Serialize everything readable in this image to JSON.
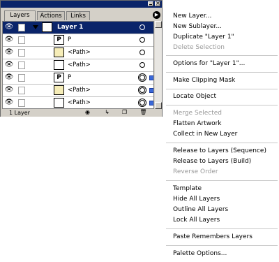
{
  "palette": {
    "tabs": [
      "Layers",
      "Actions",
      "Links"
    ],
    "layer_count": "1 Layer",
    "rows": [
      {
        "label": "Layer 1",
        "thumb": "",
        "kind": "layer"
      },
      {
        "label": "P",
        "thumb": "P",
        "kind": "text"
      },
      {
        "label": "<Path>",
        "thumb": "",
        "kind": "path"
      },
      {
        "label": "<Path>",
        "thumb": "",
        "kind": "path-white"
      },
      {
        "label": "P",
        "thumb": "P",
        "kind": "text-sel"
      },
      {
        "label": "<Path>",
        "thumb": "",
        "kind": "path-sel"
      },
      {
        "label": "<Path>",
        "thumb": "",
        "kind": "path-white-sel"
      }
    ],
    "icons": {
      "visibility": "eye-icon",
      "expand": "triangle-down-icon",
      "target": "target-circle-icon",
      "menu": "palette-menu-arrow-icon"
    }
  },
  "menu": {
    "groups": [
      [
        {
          "label": "New Layer...",
          "enabled": true
        },
        {
          "label": "New Sublayer...",
          "enabled": true
        },
        {
          "label": "Duplicate \"Layer 1\"",
          "enabled": true
        },
        {
          "label": "Delete Selection",
          "enabled": false
        }
      ],
      [
        {
          "label": "Options for \"Layer 1\"...",
          "enabled": true
        }
      ],
      [
        {
          "label": "Make Clipping Mask",
          "enabled": true
        }
      ],
      [
        {
          "label": "Locate Object",
          "enabled": true
        }
      ],
      [
        {
          "label": "Merge Selected",
          "enabled": false
        },
        {
          "label": "Flatten Artwork",
          "enabled": true
        },
        {
          "label": "Collect in New Layer",
          "enabled": true
        }
      ],
      [
        {
          "label": "Release to Layers (Sequence)",
          "enabled": true
        },
        {
          "label": "Release to Layers (Build)",
          "enabled": true
        },
        {
          "label": "Reverse Order",
          "enabled": false
        }
      ],
      [
        {
          "label": "Template",
          "enabled": true
        },
        {
          "label": "Hide All Layers",
          "enabled": true
        },
        {
          "label": "Outline All Layers",
          "enabled": true
        },
        {
          "label": "Lock All Layers",
          "enabled": true
        }
      ],
      [
        {
          "label": "Paste Remembers Layers",
          "enabled": true
        }
      ],
      [
        {
          "label": "Palette Options...",
          "enabled": true
        }
      ]
    ]
  },
  "colors": {
    "titlebar": "#0a246a",
    "selected_row": "#0a246a",
    "selection_square": "#3a68d8",
    "path_fill": "#f6edb8",
    "disabled_text": "#999999"
  }
}
